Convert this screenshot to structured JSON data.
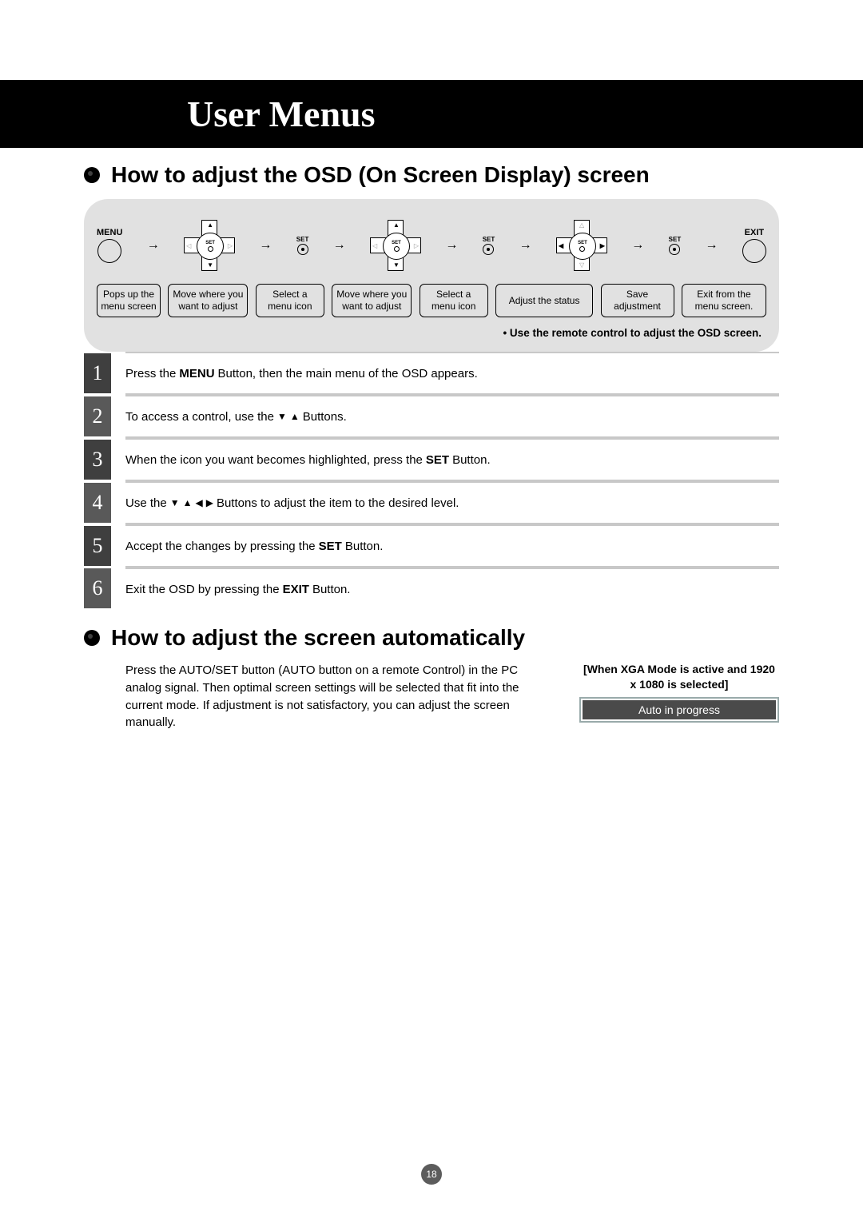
{
  "title_band": "User Menus",
  "section1_heading": "How to adjust the OSD (On Screen Display) screen",
  "flow": {
    "menu_label": "MENU",
    "set_label": "SET",
    "exit_label": "EXIT",
    "captions": [
      "Pops up the menu screen",
      "Move where you want to adjust",
      "Select a menu icon",
      "Move where you want to adjust",
      "Select a menu icon",
      "Adjust the status",
      "Save adjustment",
      "Exit from the menu screen."
    ],
    "note": "• Use the remote control to adjust the OSD screen."
  },
  "steps": [
    {
      "num": "1",
      "pre": "Press the ",
      "b1": "MENU",
      "post": " Button, then the main menu of the OSD appears."
    },
    {
      "num": "2",
      "pre": "To access a control, use the  ",
      "icons": "du",
      "post": "  Buttons."
    },
    {
      "num": "3",
      "pre": "When the icon you want becomes highlighted, press the ",
      "b1": "SET",
      "post": " Button."
    },
    {
      "num": "4",
      "pre": "Use the ",
      "icons": "dulr",
      "post": " Buttons to adjust the item to the desired level."
    },
    {
      "num": "5",
      "pre": "Accept the changes by pressing the ",
      "b1": "SET",
      "post": " Button."
    },
    {
      "num": "6",
      "pre": "Exit the OSD by pressing the ",
      "b1": "EXIT",
      "post": " Button."
    }
  ],
  "section2_heading": "How to adjust the screen automatically",
  "auto_text": "Press the AUTO/SET button (AUTO button on a remote Control) in the PC analog signal. Then optimal screen settings will be selected that fit into the current mode. If adjustment is not satisfactory, you can adjust the screen manually.",
  "auto_side_title": "[When XGA Mode is active and 1920 x 1080 is selected]",
  "auto_progress": "Auto in progress",
  "page_number": "18"
}
